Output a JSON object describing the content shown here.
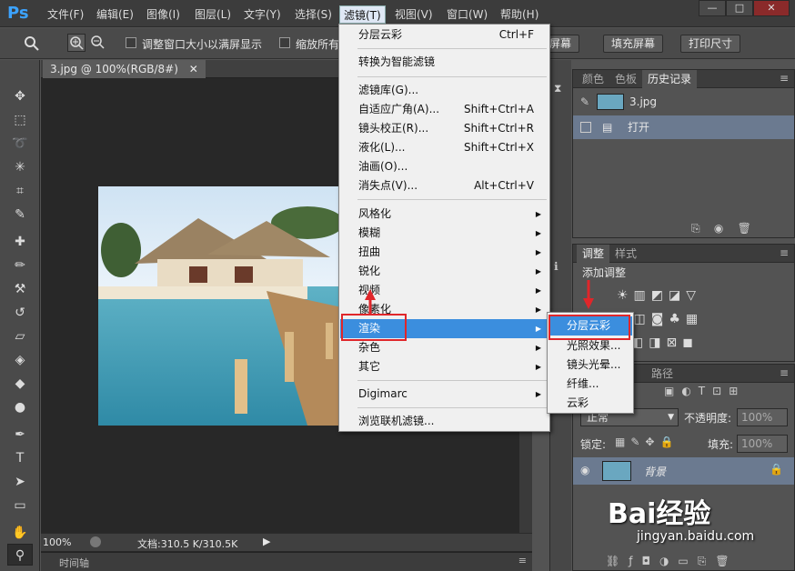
{
  "app": {
    "logo": "Ps"
  },
  "menubar": [
    "文件(F)",
    "编辑(E)",
    "图像(I)",
    "图层(L)",
    "文字(Y)",
    "选择(S)",
    "滤镜(T)",
    "视图(V)",
    "窗口(W)",
    "帮助(H)"
  ],
  "window_controls": {
    "minimize": "—",
    "restore": "□",
    "close": "✕"
  },
  "options": {
    "fit_window_label": "调整窗口大小以满屏显示",
    "zoom_all_label": "缩放所有",
    "fill_partial": "合屏幕",
    "fill_screen": "填充屏幕",
    "print_size": "打印尺寸"
  },
  "document": {
    "tab_label": "3.jpg @ 100%(RGB/8#)",
    "tab_close": "✕",
    "zoom": "100%",
    "doc_info": "文档:310.5 K/310.5K",
    "timeline_label": "时间轴"
  },
  "filter_menu": {
    "items": [
      {
        "label": "分层云彩",
        "shortcut": "Ctrl+F"
      },
      {
        "label": "转换为智能滤镜",
        "shortcut": ""
      },
      {
        "label": "滤镜库(G)...",
        "shortcut": ""
      },
      {
        "label": "自适应广角(A)...",
        "shortcut": "Shift+Ctrl+A"
      },
      {
        "label": "镜头校正(R)...",
        "shortcut": "Shift+Ctrl+R"
      },
      {
        "label": "液化(L)...",
        "shortcut": "Shift+Ctrl+X"
      },
      {
        "label": "油画(O)...",
        "shortcut": ""
      },
      {
        "label": "消失点(V)...",
        "shortcut": "Alt+Ctrl+V"
      },
      {
        "label": "风格化",
        "shortcut": ""
      },
      {
        "label": "模糊",
        "shortcut": ""
      },
      {
        "label": "扭曲",
        "shortcut": ""
      },
      {
        "label": "锐化",
        "shortcut": ""
      },
      {
        "label": "视频",
        "shortcut": ""
      },
      {
        "label": "像素化",
        "shortcut": ""
      },
      {
        "label": "渲染",
        "shortcut": ""
      },
      {
        "label": "杂色",
        "shortcut": ""
      },
      {
        "label": "其它",
        "shortcut": ""
      },
      {
        "label": "Digimarc",
        "shortcut": ""
      },
      {
        "label": "浏览联机滤镜...",
        "shortcut": ""
      }
    ]
  },
  "render_submenu": {
    "items": [
      "分层云彩",
      "光照效果...",
      "镜头光晕...",
      "纤维...",
      "云彩"
    ]
  },
  "history_panel": {
    "tabs": [
      "颜色",
      "色板",
      "历史记录"
    ],
    "snapshot_name": "3.jpg",
    "states": [
      "打开"
    ]
  },
  "adjustments_panel": {
    "tabs": [
      "调整",
      "样式"
    ],
    "title": "添加调整"
  },
  "layers_panel": {
    "tabs": [
      "路径"
    ],
    "blend_mode": "正常",
    "opacity_label": "不透明度:",
    "opacity_value": "100%",
    "lock_label": "锁定:",
    "fill_label": "填充:",
    "fill_value": "100%",
    "layer_name": "背景"
  },
  "watermark": {
    "brand": "Bai经验",
    "url": "jingyan.baidu.com"
  }
}
